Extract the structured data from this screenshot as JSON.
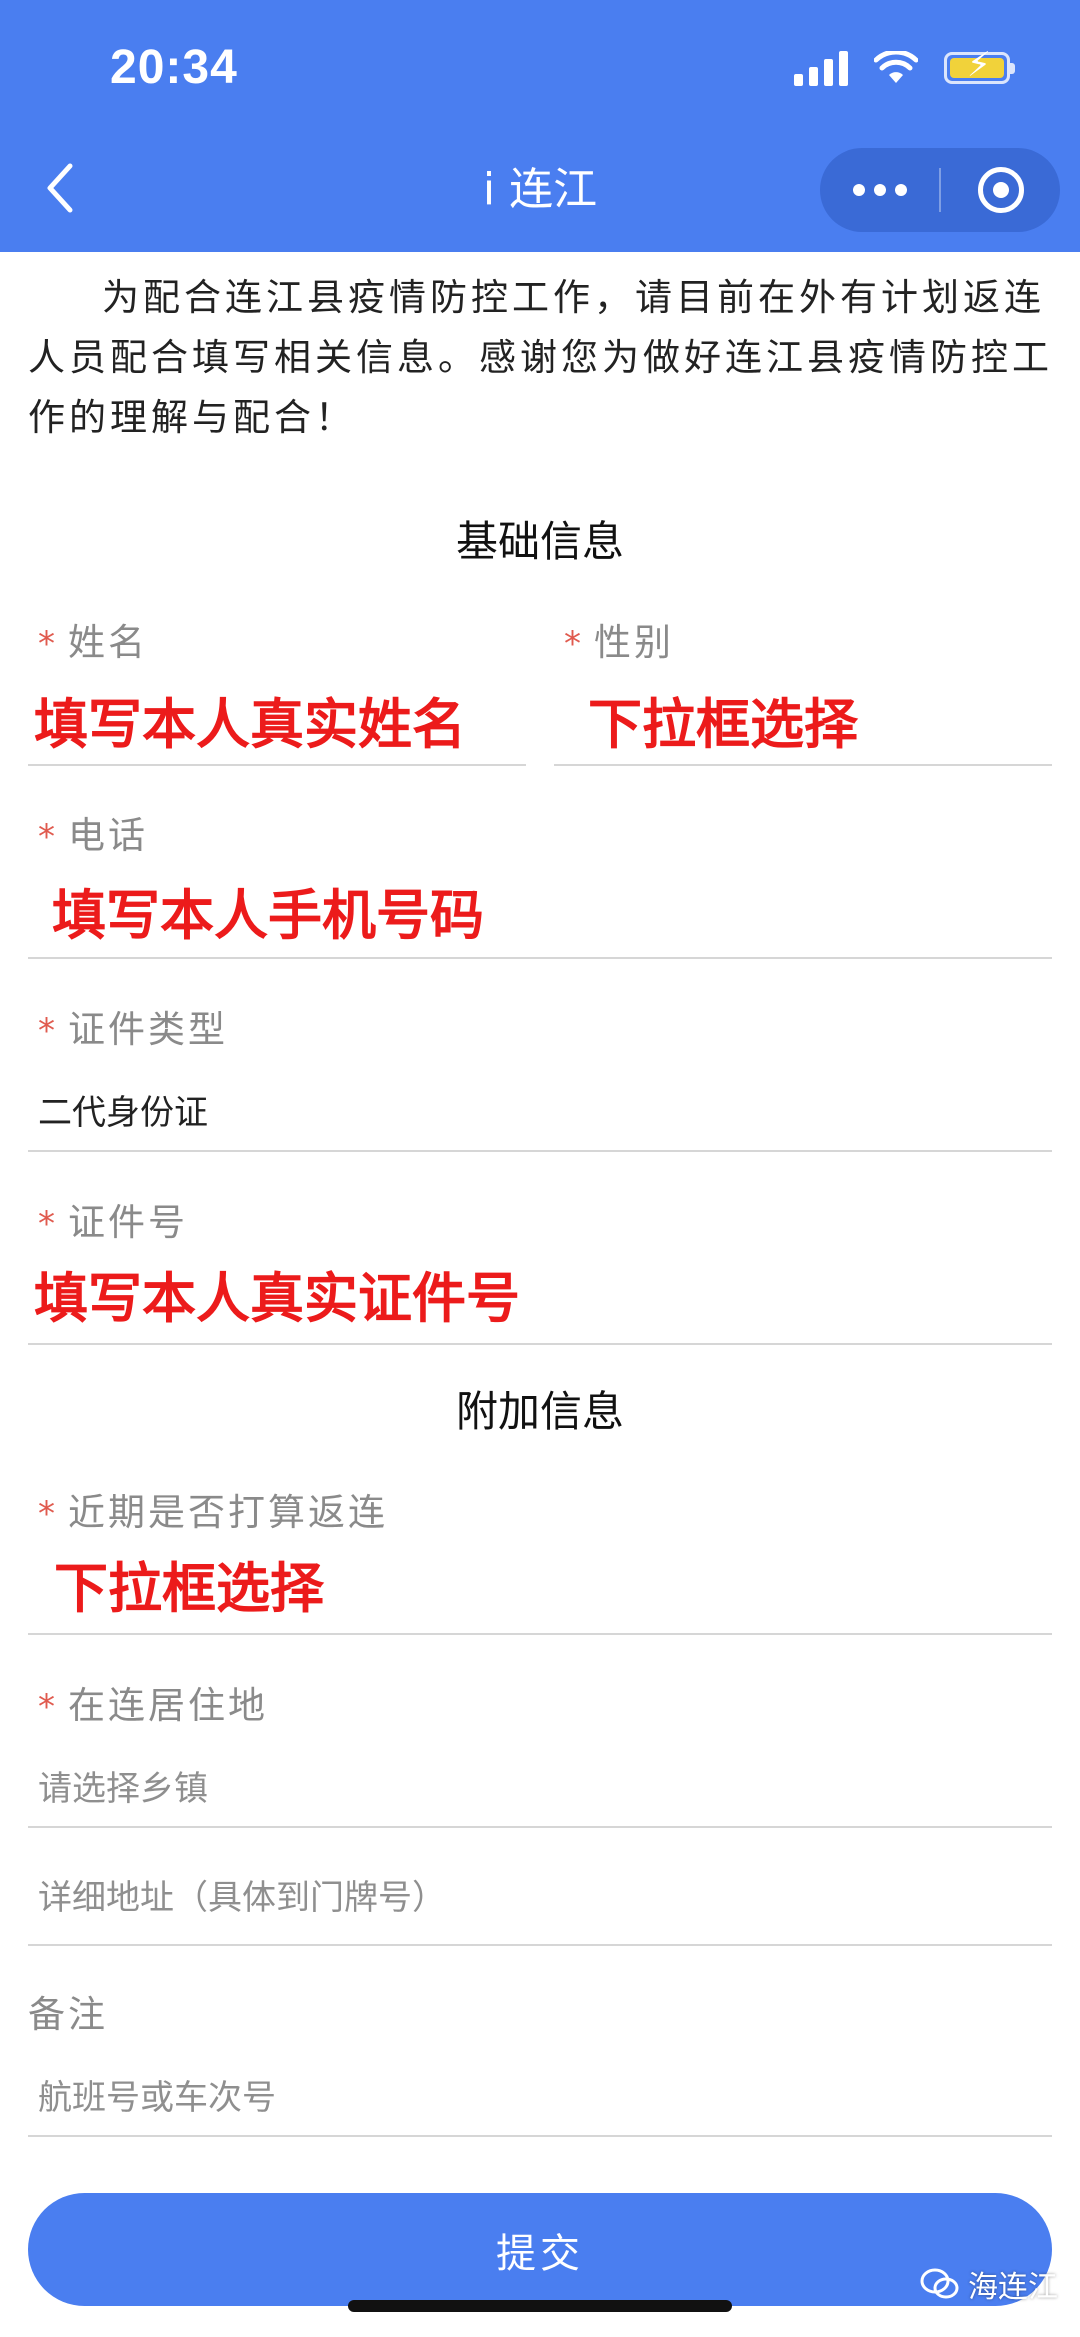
{
  "status_bar": {
    "time": "20:34"
  },
  "header": {
    "title": "i 连江"
  },
  "intro": "为配合连江县疫情防控工作，请目前在外有计划返连人员配合填写相关信息。感谢您为做好连江县疫情防控工作的理解与配合！",
  "basic_section": {
    "title": "基础信息",
    "name": {
      "star": "*",
      "label": "姓名",
      "overlay": "填写本人真实姓名"
    },
    "gender": {
      "star": "*",
      "label": "性别",
      "overlay": "下拉框选择"
    },
    "phone": {
      "star": "*",
      "label": "电话",
      "overlay": "填写本人手机号码"
    },
    "id_type": {
      "star": "*",
      "label": "证件类型",
      "value": "二代身份证"
    },
    "id_number": {
      "star": "*",
      "label": "证件号",
      "overlay": "填写本人真实证件号"
    }
  },
  "extra_section": {
    "title": "附加信息",
    "return_plan": {
      "star": "*",
      "label": "近期是否打算返连",
      "overlay": "下拉框选择"
    },
    "residence": {
      "star": "*",
      "label": "在连居住地",
      "placeholder": "请选择乡镇"
    },
    "address": {
      "placeholder": "详细地址（具体到门牌号）"
    },
    "remark": {
      "label": "备注",
      "placeholder": "航班号或车次号"
    }
  },
  "submit_label": "提交",
  "watermark": "海连江",
  "colors": {
    "header_blue": "#4a7ef0",
    "overlay_red": "#ec1b1b",
    "required_star": "#e05a4e"
  }
}
